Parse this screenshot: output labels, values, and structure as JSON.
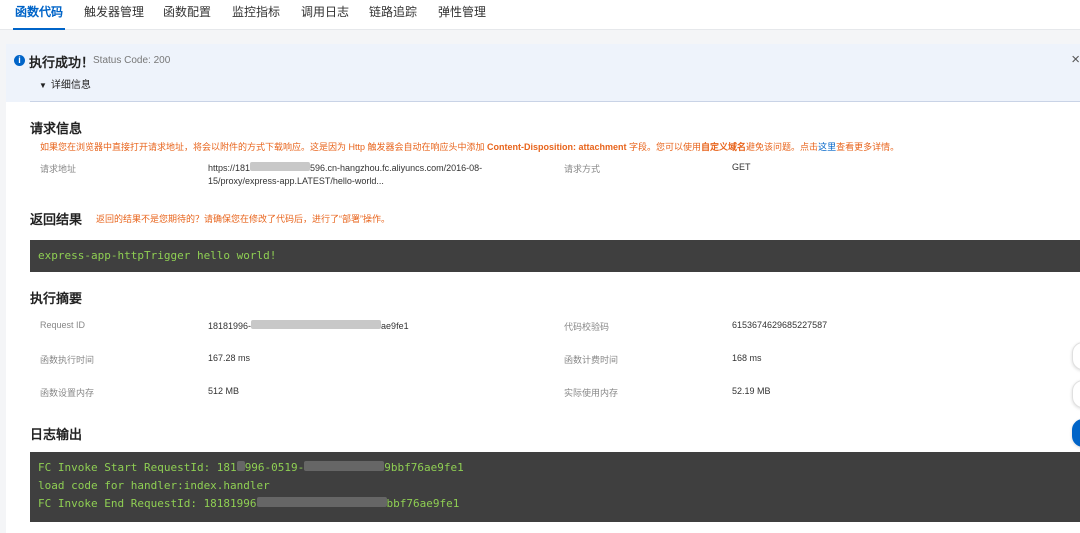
{
  "tabs": [
    "函数代码",
    "触发器管理",
    "函数配置",
    "监控指标",
    "调用日志",
    "链路追踪",
    "弹性管理"
  ],
  "result": {
    "title": "执行成功！",
    "status": "Status Code: 200",
    "details": "详细信息",
    "close": "×",
    "info_icon": "i"
  },
  "request": {
    "title": "请求信息",
    "warn_pre": "如果您在浏览器中直接打开请求地址，将会以附件的方式下载响应。这是因为 Http 触发器会自动在响应头中添加 ",
    "warn_bold1": "Content-Disposition: attachment",
    "warn_mid": " 字段。您可以使用",
    "warn_bold2": "自定义域名",
    "warn_post": "避免该问题。点击",
    "warn_link": "这里",
    "warn_end": "查看更多详情。",
    "url_label": "请求地址",
    "url_part1": "https://181",
    "url_part2": "596.cn-hangzhou.fc.aliyuncs.com/2016-08-",
    "url_line2": "15/proxy/express-app.LATEST/hello-world...",
    "method_label": "请求方式",
    "method_value": "GET"
  },
  "response": {
    "title": "返回结果",
    "warn": "返回的结果不是您期待的？请确保您在修改了代码后，进行了“部署”操作。",
    "output": "express-app-httpTrigger hello world!"
  },
  "summary": {
    "title": "执行摘要",
    "request_id_label": "Request ID",
    "request_id_start": "18181996-",
    "request_id_end": "ae9fe1",
    "checksum_label": "代码校验码",
    "checksum_value": "6153674629685227587",
    "exec_time_label": "函数执行时间",
    "exec_time_value": "167.28 ms",
    "billed_time_label": "函数计费时间",
    "billed_time_value": "168 ms",
    "memory_label": "函数设置内存",
    "memory_value": "512 MB",
    "used_memory_label": "实际使用内存",
    "used_memory_value": "52.19 MB"
  },
  "logs": {
    "title": "日志输出",
    "line1_start": "FC Invoke Start RequestId: 181",
    "line1_end": "996-0519-",
    "line1_tail": "9bbf76ae9fe1",
    "line2": "load code for handler:index.handler",
    "line3_start": "FC Invoke End RequestId: 18181996",
    "line3_tail": "bbf76ae9fe1"
  }
}
